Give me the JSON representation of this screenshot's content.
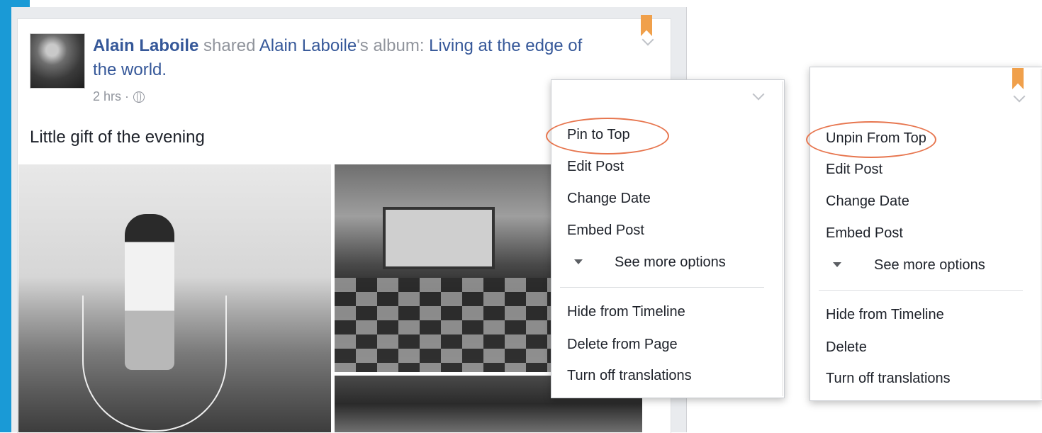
{
  "post": {
    "author": "Alain Laboile",
    "action": " shared ",
    "album_owner": "Alain Laboile",
    "possessive": "'s album: ",
    "album_title": "Living at the edge of the world.",
    "time": "2 hrs ·",
    "text": "Little gift of the evening"
  },
  "menu_pinned_off": {
    "items": [
      "Pin to Top",
      "Edit Post",
      "Change Date",
      "Embed Post"
    ],
    "more": "See more options",
    "bottom_items": [
      "Hide from Timeline",
      "Delete from Page",
      "Turn off translations"
    ]
  },
  "menu_pinned_on": {
    "items": [
      "Unpin From Top",
      "Edit Post",
      "Change Date",
      "Embed Post"
    ],
    "more": "See more options",
    "bottom_items": [
      "Hide from Timeline",
      "Delete",
      "Turn off translations"
    ]
  },
  "colors": {
    "accent_blue": "#1a9ad6",
    "link_blue": "#365899",
    "highlight_ring": "#e7764f",
    "bookmark": "#f0a04b"
  },
  "icons": [
    "globe-icon",
    "bookmark-icon",
    "chevron-down-icon",
    "caret-down-icon"
  ]
}
